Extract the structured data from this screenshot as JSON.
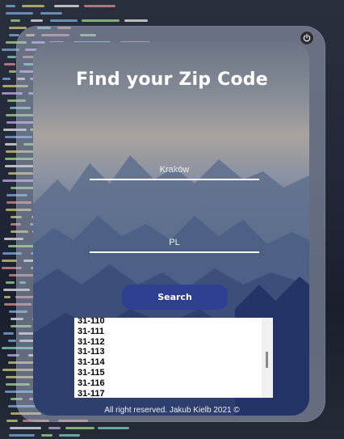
{
  "app": {
    "title": "Find your Zip Code"
  },
  "form": {
    "city_value": "Kraków",
    "country_value": "PL",
    "search_label": "Search"
  },
  "results": {
    "items": [
      "31-110",
      "31-111",
      "31-112",
      "31-113",
      "31-114",
      "31-115",
      "31-116",
      "31-117"
    ]
  },
  "footer": {
    "text": "All right reserved. Jakub Kielb 2021 ©"
  },
  "icons": {
    "power": "power-icon"
  },
  "colors": {
    "accent": "#2f3f92",
    "text": "#ffffff",
    "list_bg": "#ffffff"
  }
}
